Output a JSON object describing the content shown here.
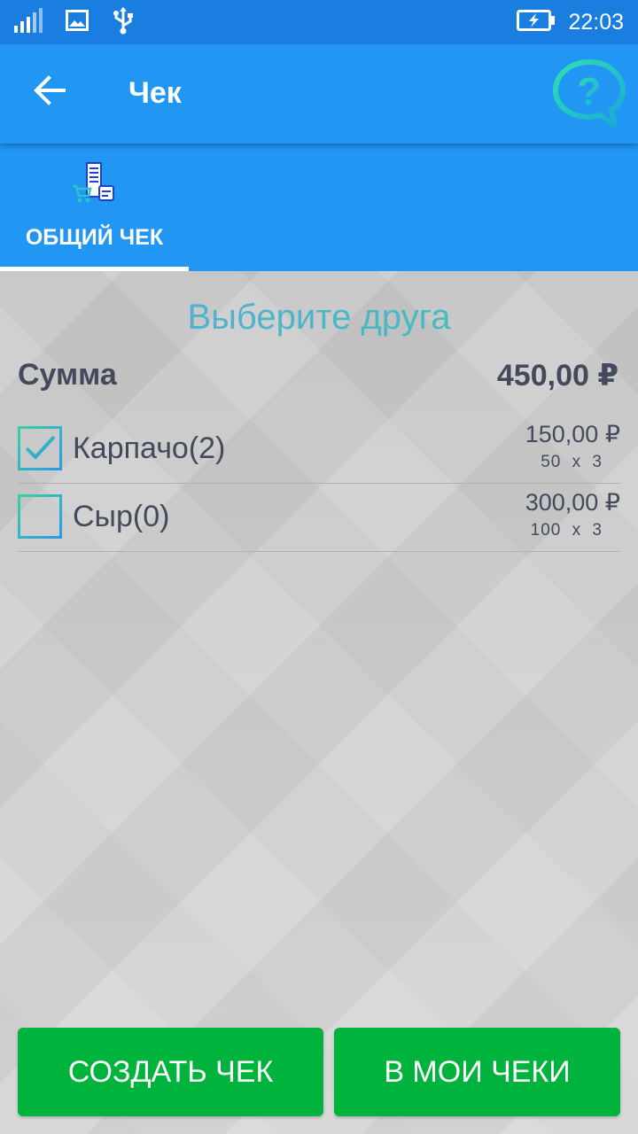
{
  "status_bar": {
    "time": "22:03",
    "icons": [
      "signal-icon",
      "image-icon",
      "usb-icon",
      "battery-charging-icon"
    ]
  },
  "app_bar": {
    "title": "Чек",
    "back_icon": "arrow-back-icon",
    "help_icon": "help-bubble-icon"
  },
  "tabs": [
    {
      "label": "ОБЩИЙ ЧЕК",
      "icon": "receipt-cart-icon",
      "selected": true
    }
  ],
  "content": {
    "choose_friend": "Выберите друга",
    "sum_label": "Сумма",
    "sum_value": "450,00 ₽",
    "items": [
      {
        "name": "Карпачо(2)",
        "price": "150,00 ₽",
        "qty": "50 x 3",
        "checked": true
      },
      {
        "name": "Сыр(0)",
        "price": "300,00 ₽",
        "qty": "100 x 3",
        "checked": false
      }
    ]
  },
  "buttons": {
    "create_label": "СОЗДАТЬ ЧЕК",
    "my_checks_label": "В МОИ ЧЕКИ"
  },
  "colors": {
    "status_bar": "#1a7de0",
    "app_bar": "#2196f3",
    "button_green": "#00b33c",
    "text_dark": "#424a5c"
  }
}
